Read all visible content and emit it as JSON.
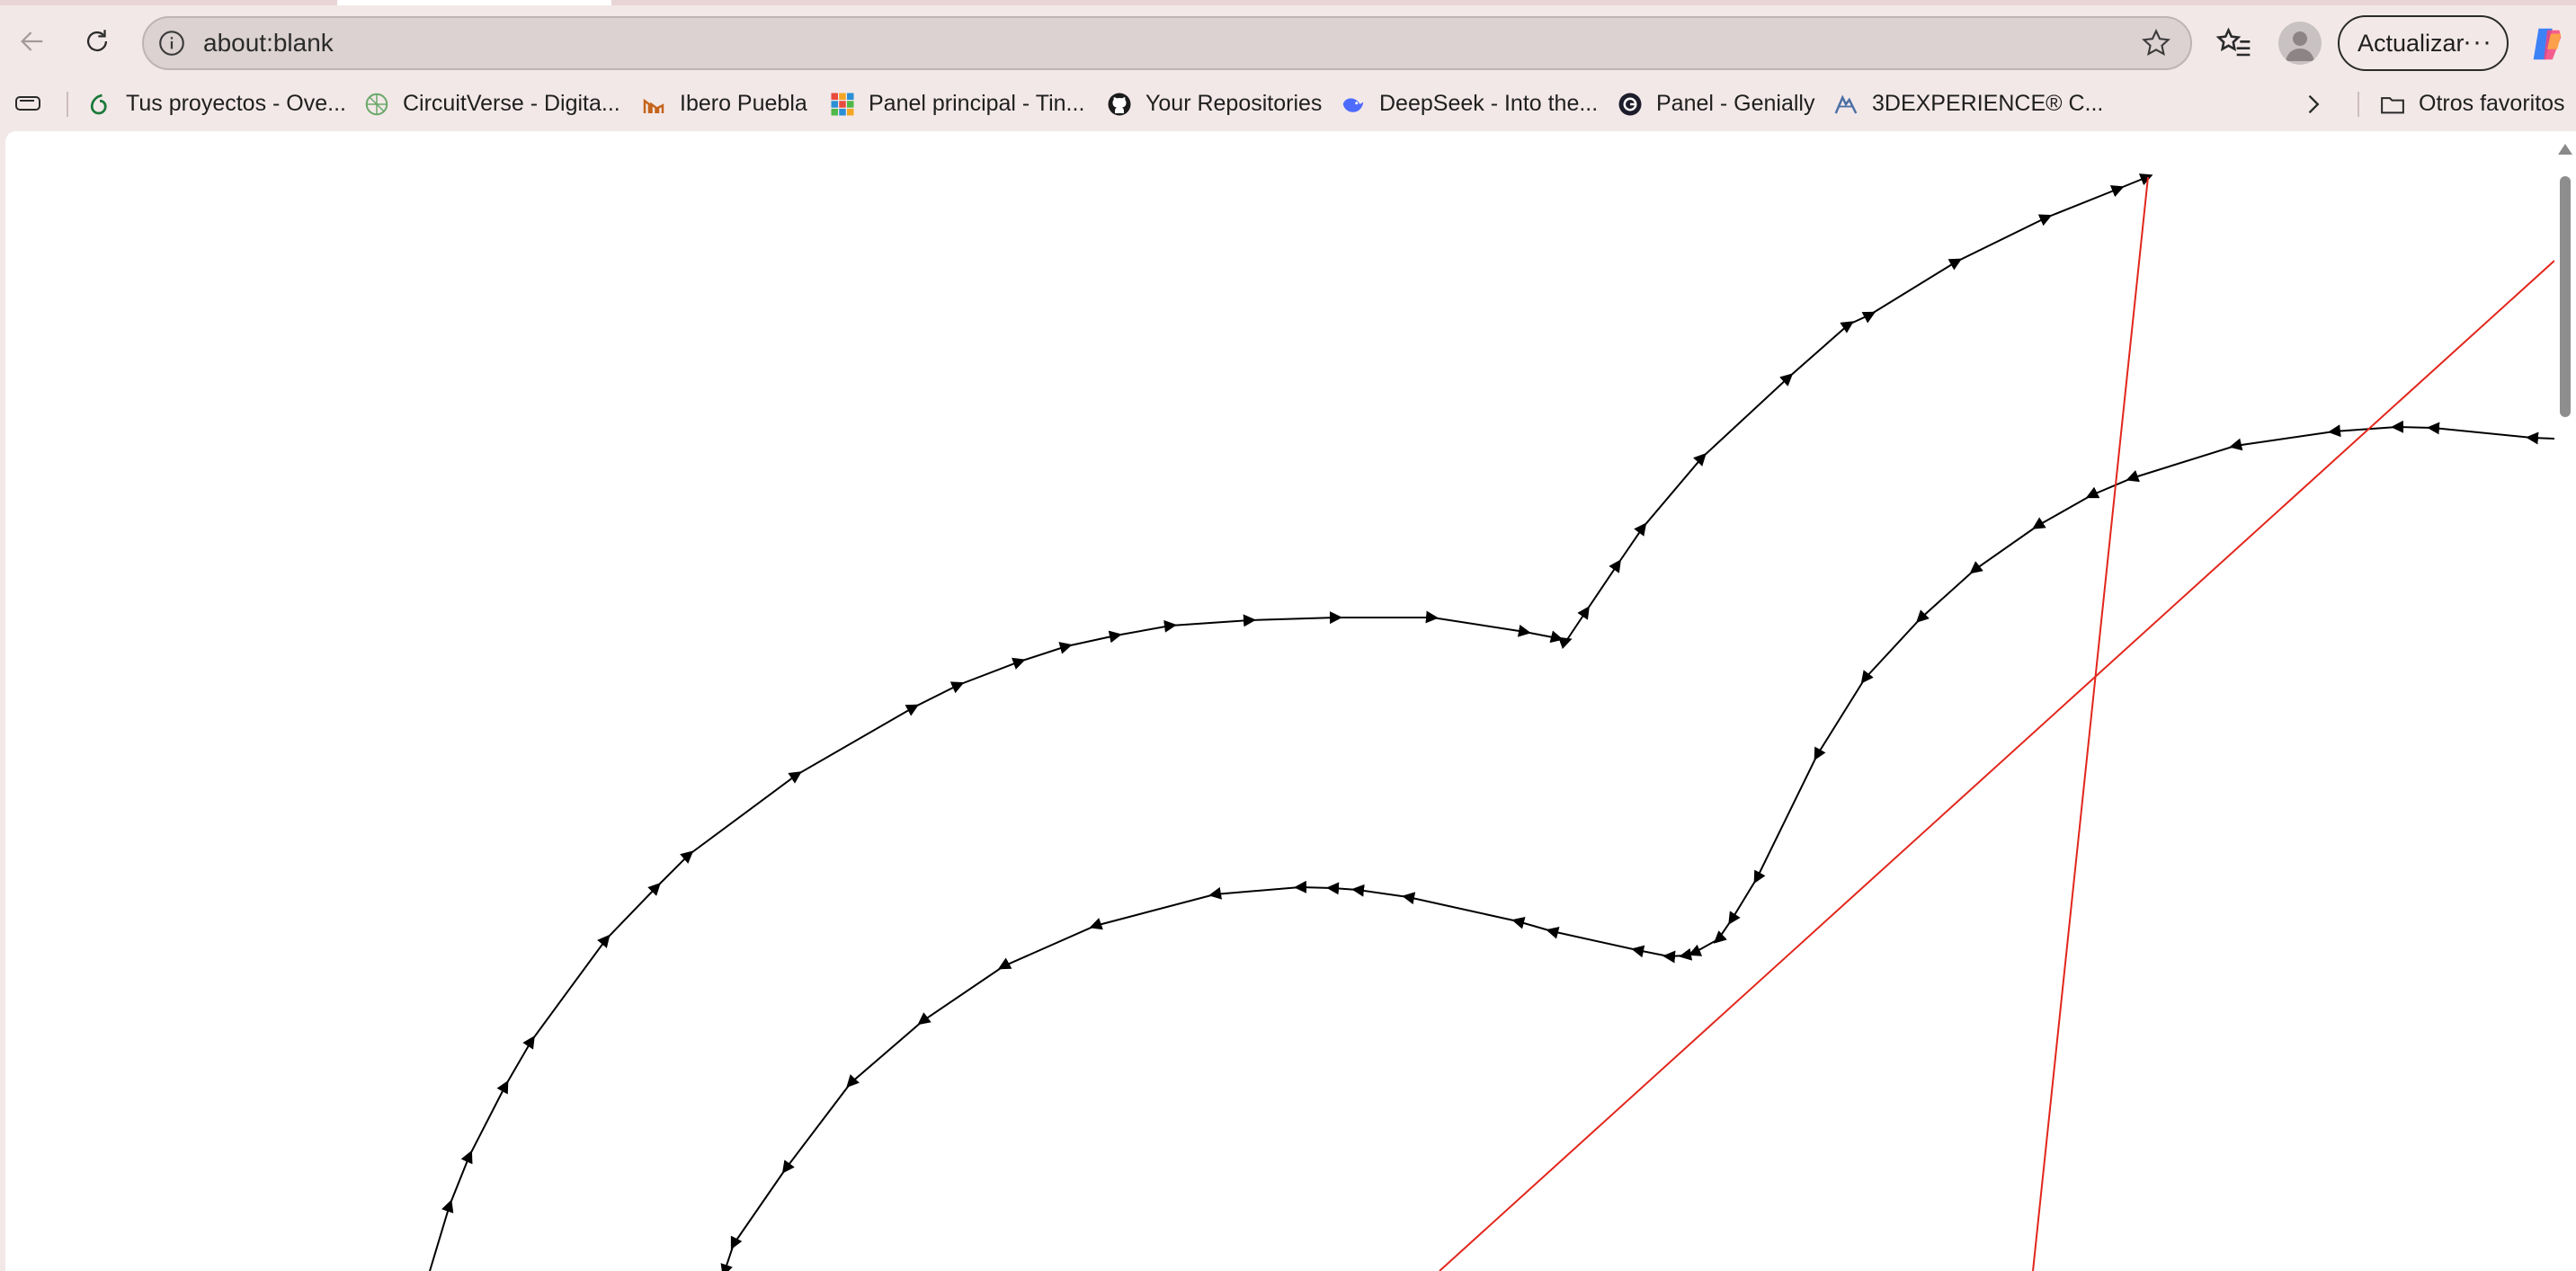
{
  "browser": {
    "address_bar": {
      "url": "about:blank"
    },
    "update_button": {
      "label": "Actualizar",
      "more_label": "···"
    }
  },
  "bookmarks": [
    {
      "label": "Tus proyectos - Ove...",
      "icon": "overleaf-icon"
    },
    {
      "label": "CircuitVerse - Digita...",
      "icon": "circuitverse-icon"
    },
    {
      "label": "Ibero Puebla",
      "icon": "ibero-icon"
    },
    {
      "label": "Panel principal - Tin...",
      "icon": "tinkercad-icon"
    },
    {
      "label": "Your Repositories",
      "icon": "github-icon"
    },
    {
      "label": "DeepSeek - Into the...",
      "icon": "deepseek-icon"
    },
    {
      "label": "Panel - Genially",
      "icon": "genially-icon"
    },
    {
      "label": "3DEXPERIENCE® C...",
      "icon": "3dexperience-icon"
    }
  ],
  "other_favorites": {
    "label": "Otros favoritos",
    "icon": "folder-icon"
  },
  "colors": {
    "path_stroke": "#000000",
    "line_stroke": "#e2261c",
    "browser_frame": "#f3e8e8"
  }
}
